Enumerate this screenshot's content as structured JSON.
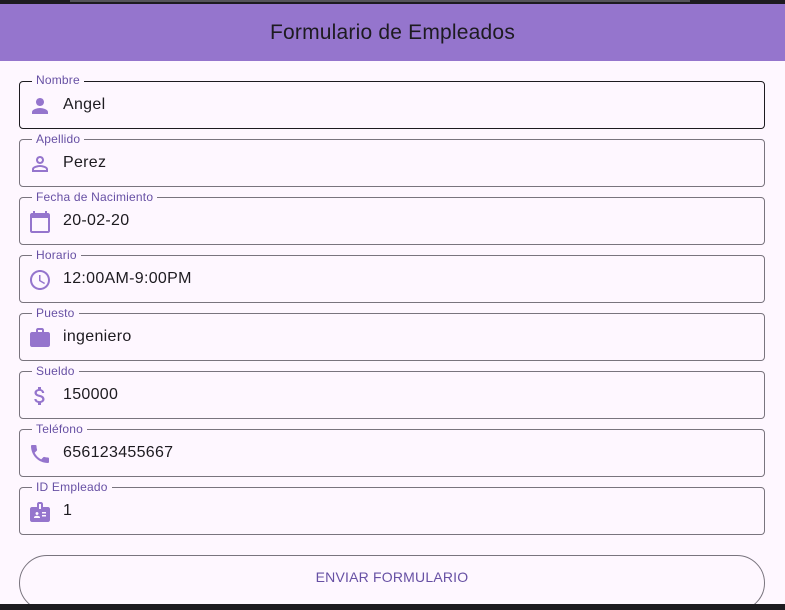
{
  "app": {
    "title": "Formulario de Empleados"
  },
  "form": {
    "fields": [
      {
        "label": "Nombre",
        "value": "Angel",
        "icon": "person-icon"
      },
      {
        "label": "Apellido",
        "value": "Perez",
        "icon": "person-outline-icon"
      },
      {
        "label": "Fecha de Nacimiento",
        "value": "20-02-20",
        "icon": "calendar-icon"
      },
      {
        "label": "Horario",
        "value": "12:00AM-9:00PM",
        "icon": "clock-icon"
      },
      {
        "label": "Puesto",
        "value": "ingeniero",
        "icon": "briefcase-icon"
      },
      {
        "label": "Sueldo",
        "value": "150000",
        "icon": "dollar-icon"
      },
      {
        "label": "Teléfono",
        "value": "656123455667",
        "icon": "phone-icon"
      },
      {
        "label": "ID Empleado",
        "value": "1",
        "icon": "badge-icon"
      }
    ],
    "submit_label": "ENVIAR FORMULARIO"
  },
  "colors": {
    "appbar": "#9575cd",
    "accent": "#6750a4",
    "icon": "#9575cd",
    "background": "#fef7ff"
  }
}
